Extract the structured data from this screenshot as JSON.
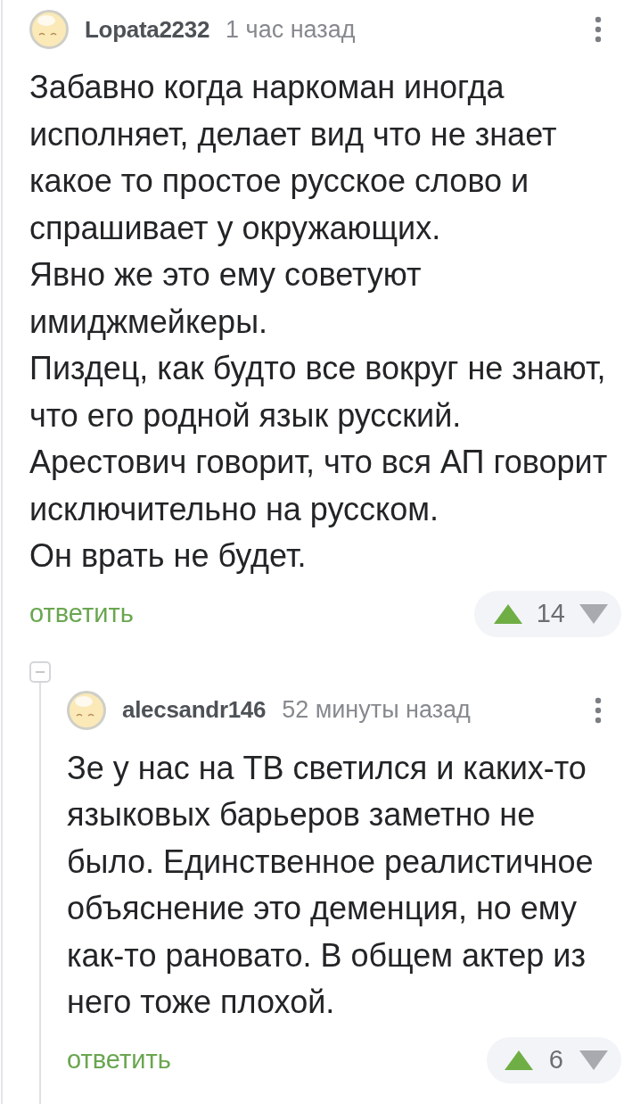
{
  "comments": [
    {
      "author": "Lopata2232",
      "time": "1 час назад",
      "paragraphs": [
        "Забавно когда наркоман иногда исполняет, делает вид что не знает какое то простое русское слово и спрашивает у окружающих.",
        "Явно же это ему советуют имиджмейкеры.",
        "Пиздец, как будто все вокруг не знают, что его родной язык русский.",
        "Арестович говорит, что вся АП говорит исключительно на русском.",
        "Он врать не будет."
      ],
      "reply": "ответить",
      "rating": "14",
      "children": [
        {
          "author": "alecsandr146",
          "time": "52 минуты назад",
          "paragraphs": [
            "Зе у нас на ТВ светился и каких-то языковых барьеров заметно не было. Единственное реалистичное объяснение это деменция, но ему как-то рановато. В общем актер из него тоже плохой."
          ],
          "reply": "ответить",
          "rating": "6"
        }
      ]
    }
  ]
}
